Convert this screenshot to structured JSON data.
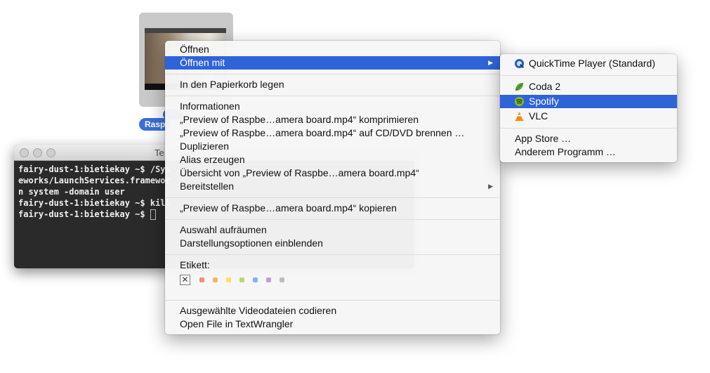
{
  "file": {
    "label": "Rasp"
  },
  "terminal": {
    "title": "Te",
    "lines": [
      "fairy-dust-1:bietiekay ~$ /Sys",
      "eworks/LaunchServices.framewor",
      "n system -domain user",
      "fairy-dust-1:bietiekay ~$ kill",
      "fairy-dust-1:bietiekay ~$ "
    ]
  },
  "menu": {
    "open": "Öffnen",
    "open_with": "Öffnen mit",
    "trash": "In den Papierkorb legen",
    "info": "Informationen",
    "compress": "„Preview of Raspbe…amera board.mp4“ komprimieren",
    "burn": "„Preview of Raspbe…amera board.mp4“ auf CD/DVD brennen …",
    "duplicate": "Duplizieren",
    "alias": "Alias erzeugen",
    "quicklook": "Übersicht von „Preview of Raspbe…amera board.mp4“",
    "share": "Bereitstellen",
    "copy": "„Preview of Raspbe…amera board.mp4“ kopieren",
    "cleanup": "Auswahl aufräumen",
    "view_options": "Darstellungsoptionen einblenden",
    "label_heading": "Etikett:",
    "encode": "Ausgewählte Videodateien codieren",
    "textwrangler": "Open File in TextWrangler"
  },
  "tag_colors": [
    "#f28b82",
    "#f6b26b",
    "#ffe066",
    "#b5d96b",
    "#7fb3f5",
    "#c39be0",
    "#bdbdbd"
  ],
  "submenu": {
    "quicktime": "QuickTime Player (Standard)",
    "coda": "Coda 2",
    "spotify": "Spotify",
    "vlc": "VLC",
    "appstore": "App Store …",
    "other": "Anderem Programm …"
  },
  "colors": {
    "highlight": "#2f63d8"
  }
}
